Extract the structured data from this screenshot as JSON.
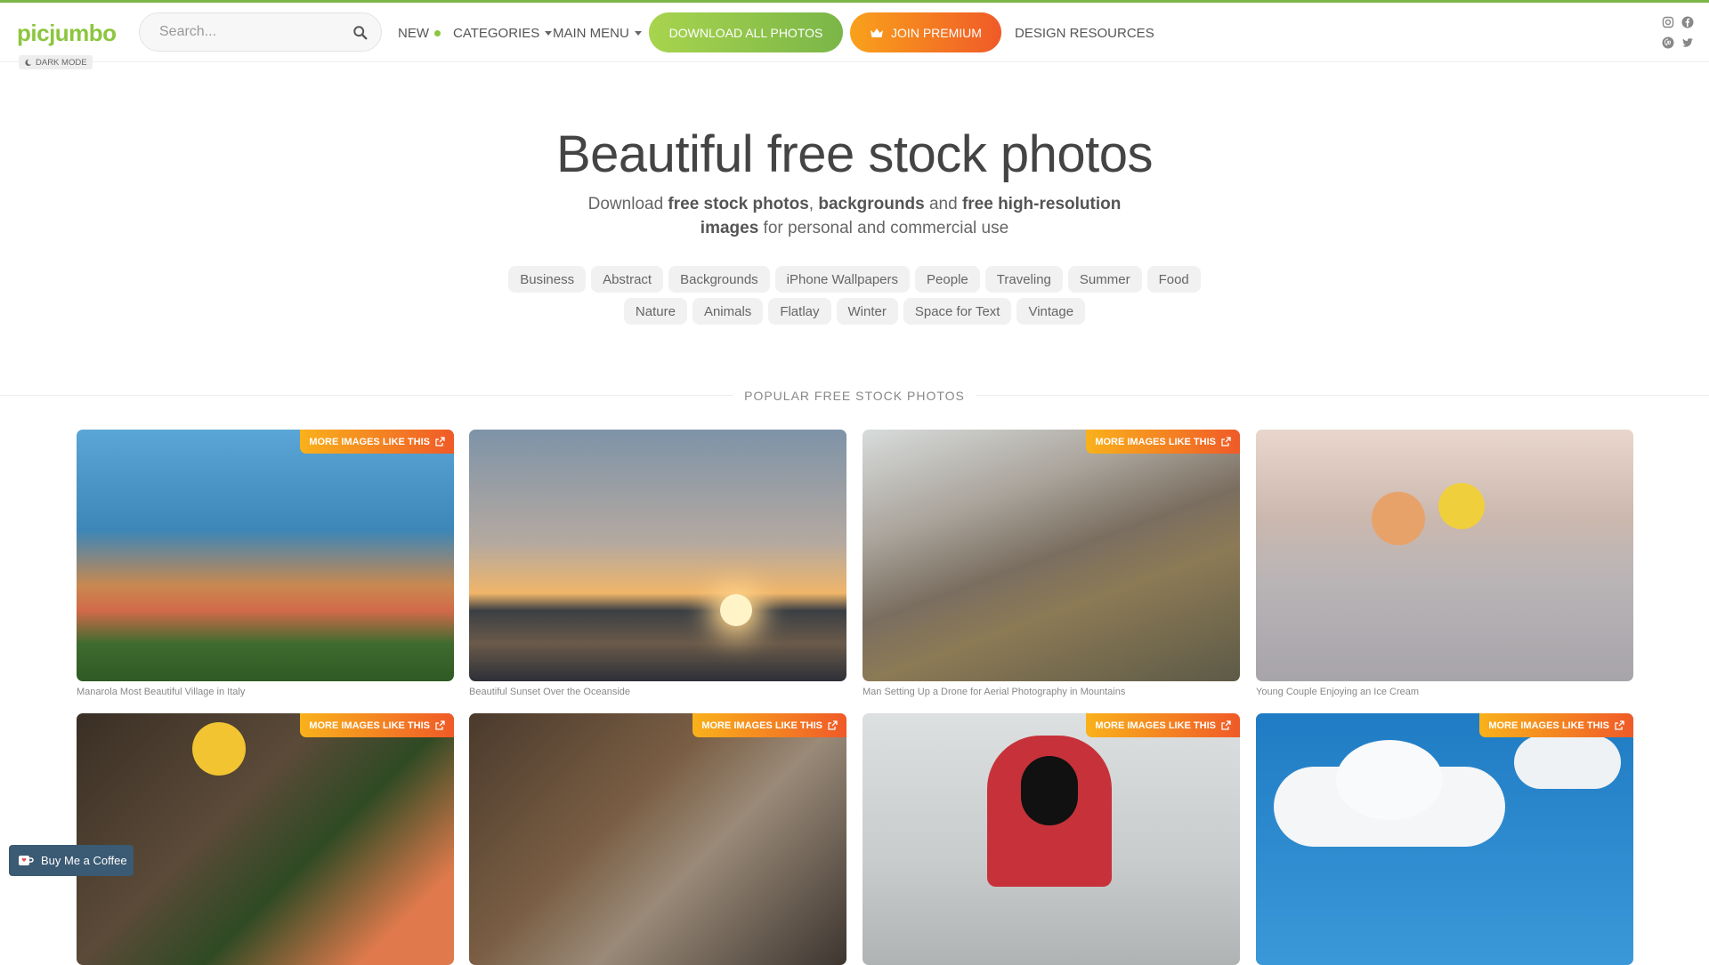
{
  "brand": {
    "logo": "picjumbo",
    "dark_mode": "DARK MODE"
  },
  "search": {
    "placeholder": "Search..."
  },
  "nav": {
    "new": "NEW",
    "categories": "CATEGORIES",
    "main_menu": "MAIN MENU",
    "download_all": "DOWNLOAD ALL PHOTOS",
    "join_premium": "JOIN PREMIUM",
    "design_resources": "DESIGN RESOURCES"
  },
  "social": [
    "instagram-icon",
    "facebook-icon",
    "pinterest-icon",
    "twitter-icon"
  ],
  "hero": {
    "title": "Beautiful free stock photos",
    "sub_1": "Download ",
    "sub_b1": "free stock photos",
    "sub_2": ", ",
    "sub_b2": "backgrounds",
    "sub_3": " and ",
    "sub_b3": "free high-resolution images",
    "sub_4": " for personal and commercial use"
  },
  "tags_row1": [
    "Business",
    "Abstract",
    "Backgrounds",
    "iPhone Wallpapers",
    "People",
    "Traveling",
    "Summer",
    "Food"
  ],
  "tags_row2": [
    "Nature",
    "Animals",
    "Flatlay",
    "Winter",
    "Space for Text",
    "Vintage"
  ],
  "section_title": "POPULAR FREE STOCK PHOTOS",
  "more_label": "MORE IMAGES LIKE THIS",
  "photos": [
    {
      "caption": "Manarola Most Beautiful Village in Italy",
      "has_more": true
    },
    {
      "caption": "Beautiful Sunset Over the Oceanside",
      "has_more": false
    },
    {
      "caption": "Man Setting Up a Drone for Aerial Photography in Mountains",
      "has_more": true
    },
    {
      "caption": "Young Couple Enjoying an Ice Cream",
      "has_more": false
    },
    {
      "caption": "",
      "has_more": true
    },
    {
      "caption": "",
      "has_more": true
    },
    {
      "caption": "",
      "has_more": true
    },
    {
      "caption": "",
      "has_more": true
    }
  ],
  "coffee": {
    "label": "Buy Me a Coffee"
  },
  "colors": {
    "accent_green": "#8cc63f",
    "premium_orange": "#f05a28"
  }
}
